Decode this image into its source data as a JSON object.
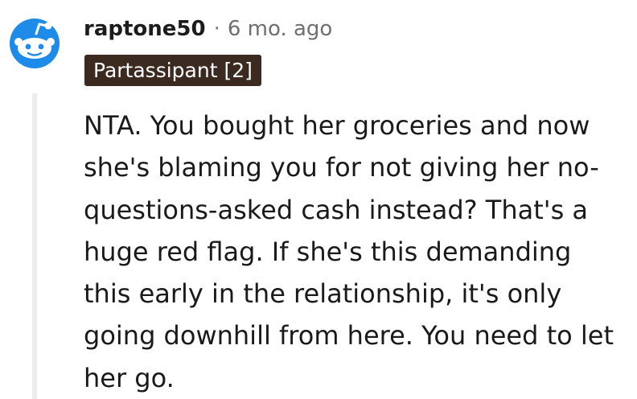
{
  "comment": {
    "author": "raptone50",
    "separator": "·",
    "timestamp": "6 mo. ago",
    "flair": "Partassipant [2]",
    "body": "NTA. You bought her groceries and now she's blaming you for not giving her no-questions-asked cash instead? That's a huge red flag. If she's this demanding this early in the relationship, it's only going downhill from here. You need to let her go.",
    "avatar_icon": "reddit-snoo-avatar-icon"
  },
  "colors": {
    "avatar_blue": "#1e8be8",
    "flair_background": "#3b2a20",
    "thread_line": "#ececec",
    "meta_text": "#6f6f6f"
  }
}
